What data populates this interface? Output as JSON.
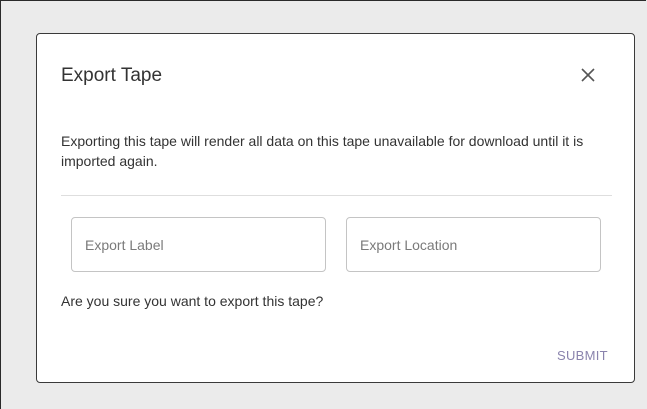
{
  "dialog": {
    "title": "Export Tape",
    "message": "Exporting this tape will render all data on this tape unavailable for download until it is imported again.",
    "fields": [
      {
        "placeholder": "Export Label",
        "value": ""
      },
      {
        "placeholder": "Export Location",
        "value": ""
      }
    ],
    "question": "Are you sure you want to export this tape?",
    "submit_label": "SUBMIT",
    "close_icon": "close-icon"
  },
  "colors": {
    "submit": "#8a83ad",
    "text": "#333333",
    "backdrop": "#ebebeb"
  }
}
